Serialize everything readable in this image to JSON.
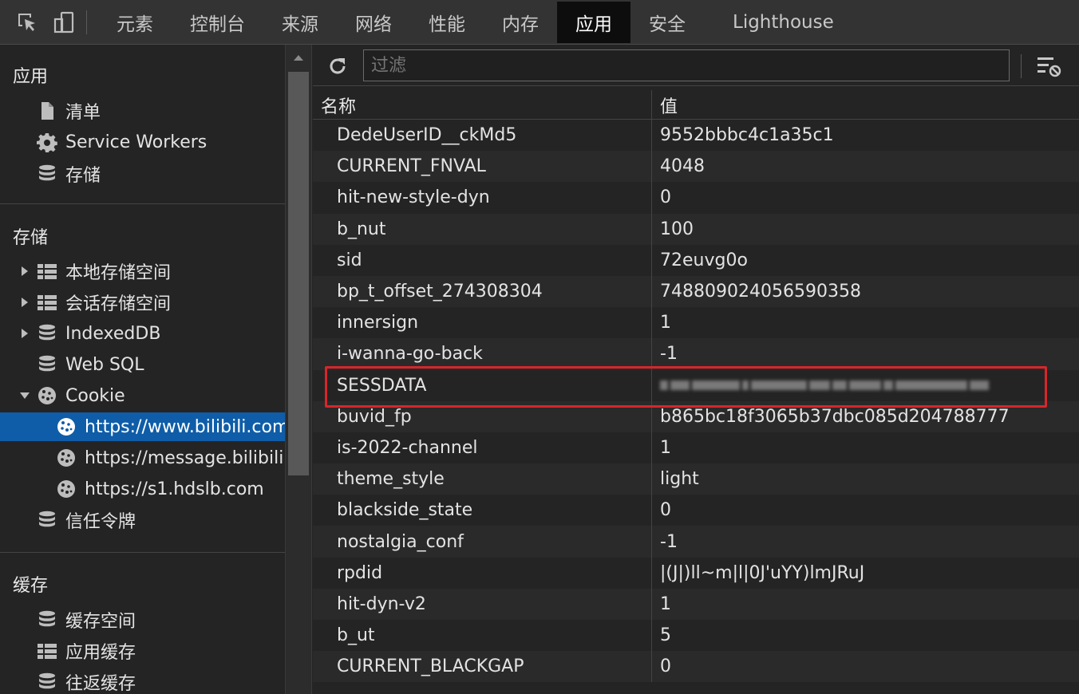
{
  "tabs": [
    {
      "label": "元素",
      "active": false
    },
    {
      "label": "控制台",
      "active": false
    },
    {
      "label": "来源",
      "active": false
    },
    {
      "label": "网络",
      "active": false
    },
    {
      "label": "性能",
      "active": false
    },
    {
      "label": "内存",
      "active": false
    },
    {
      "label": "应用",
      "active": true
    },
    {
      "label": "安全",
      "active": false
    },
    {
      "label": "Lighthouse",
      "active": false
    }
  ],
  "sidebar": {
    "app_section": {
      "title": "应用",
      "items": [
        {
          "label": "清单",
          "icon": "file-icon"
        },
        {
          "label": "Service Workers",
          "icon": "gear-icon"
        },
        {
          "label": "存储",
          "icon": "database-icon"
        }
      ]
    },
    "storage_section": {
      "title": "存储",
      "items": [
        {
          "label": "本地存储空间",
          "icon": "table-icon",
          "expandable": true,
          "expanded": false
        },
        {
          "label": "会话存储空间",
          "icon": "table-icon",
          "expandable": true,
          "expanded": false
        },
        {
          "label": "IndexedDB",
          "icon": "database-icon",
          "expandable": true,
          "expanded": false
        },
        {
          "label": "Web SQL",
          "icon": "database-icon",
          "expandable": false
        },
        {
          "label": "Cookie",
          "icon": "cookie-icon",
          "expandable": true,
          "expanded": true
        },
        {
          "label": "https://www.bilibili.com",
          "icon": "cookie-icon",
          "selected": true,
          "child": true
        },
        {
          "label": "https://message.bilibili.com",
          "icon": "cookie-icon",
          "child": true
        },
        {
          "label": "https://s1.hdslb.com",
          "icon": "cookie-icon",
          "child": true
        },
        {
          "label": "信任令牌",
          "icon": "database-icon"
        }
      ]
    },
    "cache_section": {
      "title": "缓存",
      "items": [
        {
          "label": "缓存空间",
          "icon": "database-icon"
        },
        {
          "label": "应用缓存",
          "icon": "table-icon"
        },
        {
          "label": "往返缓存",
          "icon": "database-icon"
        }
      ]
    }
  },
  "toolbar": {
    "filter_placeholder": "过滤"
  },
  "grid": {
    "headers": {
      "name": "名称",
      "value": "值"
    },
    "rows": [
      {
        "name": "DedeUserID__ckMd5",
        "value": "9552bbbc4c1a35c1"
      },
      {
        "name": "CURRENT_FNVAL",
        "value": "4048"
      },
      {
        "name": "hit-new-style-dyn",
        "value": "0"
      },
      {
        "name": "b_nut",
        "value": "100"
      },
      {
        "name": "sid",
        "value": "72euvg0o"
      },
      {
        "name": "bp_t_offset_274308304",
        "value": "748809024056590358"
      },
      {
        "name": "innersign",
        "value": "1"
      },
      {
        "name": "i-wanna-go-back",
        "value": "-1"
      },
      {
        "name": "SESSDATA",
        "value": "",
        "redacted": true,
        "highlighted": true
      },
      {
        "name": "buvid_fp",
        "value": "b865bc18f3065b37dbc085d204788777"
      },
      {
        "name": "is-2022-channel",
        "value": "1"
      },
      {
        "name": "theme_style",
        "value": "light"
      },
      {
        "name": "blackside_state",
        "value": "0"
      },
      {
        "name": "nostalgia_conf",
        "value": "-1"
      },
      {
        "name": "rpdid",
        "value": "|(J|)ll~m|l|0J'uYY)lmJRuJ"
      },
      {
        "name": "hit-dyn-v2",
        "value": "1"
      },
      {
        "name": "b_ut",
        "value": "5"
      },
      {
        "name": "CURRENT_BLACKGAP",
        "value": "0"
      }
    ]
  },
  "colors": {
    "selection": "#0f5da8",
    "highlight_box": "#d7262b"
  }
}
